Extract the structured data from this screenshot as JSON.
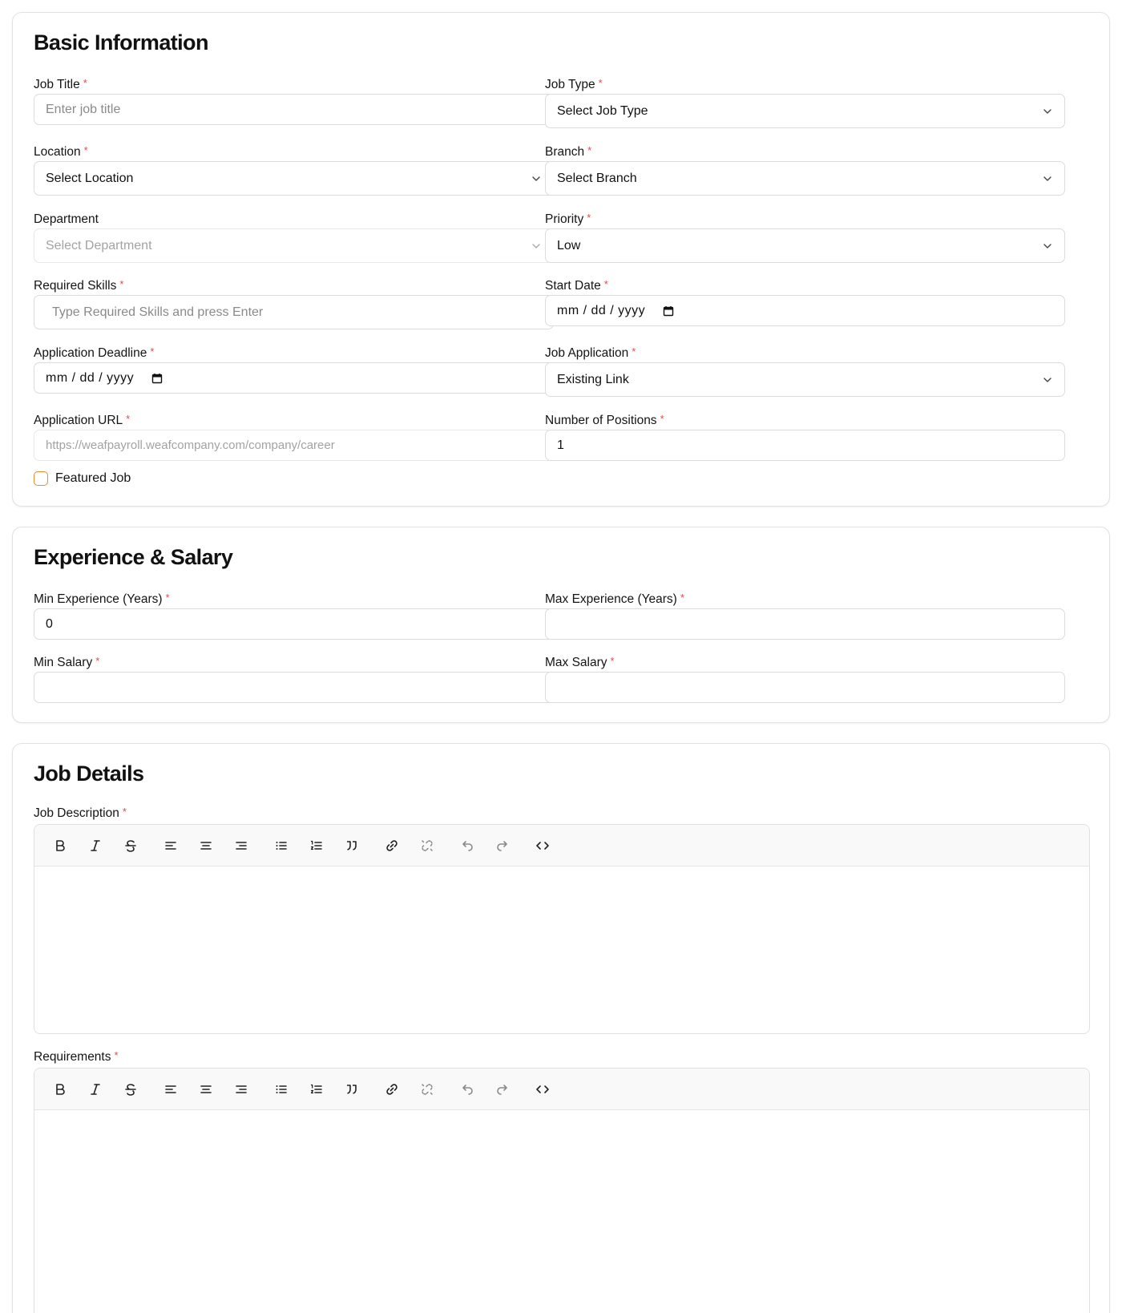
{
  "basic": {
    "title": "Basic Information",
    "job_title": {
      "label": "Job Title",
      "placeholder": "Enter job title"
    },
    "job_type": {
      "label": "Job Type",
      "value": "Select Job Type"
    },
    "location": {
      "label": "Location",
      "value": "Select Location"
    },
    "branch": {
      "label": "Branch",
      "value": "Select Branch"
    },
    "department": {
      "label": "Department",
      "value": "Select Department"
    },
    "priority": {
      "label": "Priority",
      "value": "Low"
    },
    "skills": {
      "label": "Required Skills",
      "placeholder": "Type Required Skills and press Enter"
    },
    "start_date": {
      "label": "Start Date",
      "value": "mm / dd / yyyy"
    },
    "deadline": {
      "label": "Application Deadline",
      "value": "mm / dd / yyyy"
    },
    "job_application": {
      "label": "Job Application",
      "value": "Existing Link"
    },
    "app_url": {
      "label": "Application URL",
      "placeholder": "https://weafpayroll.weafcompany.com/company/career"
    },
    "positions": {
      "label": "Number of Positions",
      "value": "1"
    },
    "featured": {
      "label": "Featured Job"
    }
  },
  "experience": {
    "title": "Experience & Salary",
    "min_exp": {
      "label": "Min Experience (Years)",
      "value": "0"
    },
    "max_exp": {
      "label": "Max Experience (Years)",
      "value": ""
    },
    "min_salary": {
      "label": "Min Salary",
      "value": ""
    },
    "max_salary": {
      "label": "Max Salary",
      "value": ""
    }
  },
  "details": {
    "title": "Job Details",
    "description": {
      "label": "Job Description"
    },
    "requirements": {
      "label": "Requirements"
    }
  },
  "required_marker": "*",
  "colors": {
    "required": "#e5484d",
    "checkbox_border": "#e58a2e",
    "border": "#dcdcdc"
  },
  "toolbar_icons": [
    "bold-icon",
    "italic-icon",
    "strikethrough-icon",
    "align-left-icon",
    "align-center-icon",
    "align-right-icon",
    "bullet-list-icon",
    "ordered-list-icon",
    "blockquote-icon",
    "link-icon",
    "unlink-icon",
    "undo-icon",
    "redo-icon",
    "code-icon"
  ]
}
